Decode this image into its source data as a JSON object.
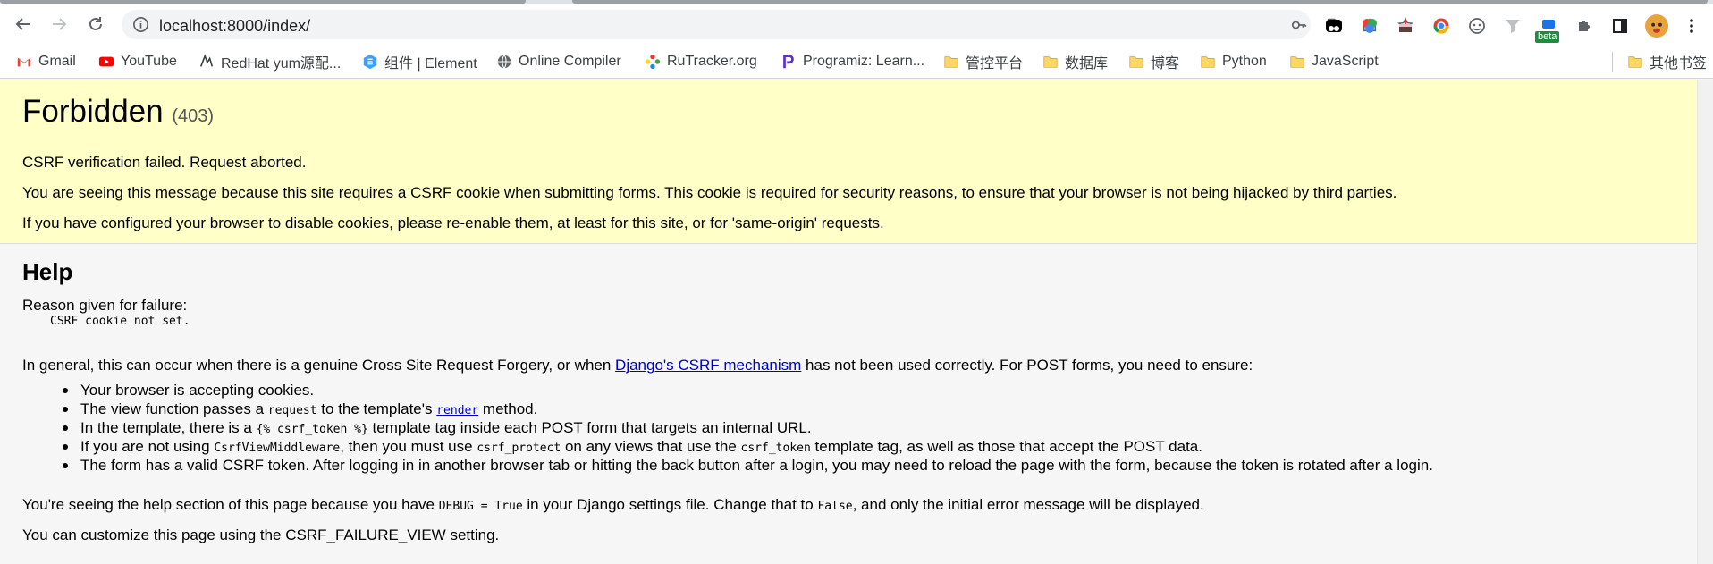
{
  "browser": {
    "url": "localhost:8000/index/",
    "extension_badge": "beta",
    "bookmarks": [
      {
        "label": "Gmail",
        "icon": "gmail-icon"
      },
      {
        "label": "YouTube",
        "icon": "youtube-icon"
      },
      {
        "label": "RedHat yum源配...",
        "icon": "redhat-icon"
      },
      {
        "label": "组件 | Element",
        "icon": "element-icon"
      },
      {
        "label": "Online Compiler",
        "icon": "globe-icon"
      },
      {
        "label": "RuTracker.org",
        "icon": "rutracker-icon"
      },
      {
        "label": "Programiz: Learn...",
        "icon": "programiz-icon"
      },
      {
        "label": "管控平台",
        "icon": "folder-icon"
      },
      {
        "label": "数据库",
        "icon": "folder-icon"
      },
      {
        "label": "博客",
        "icon": "folder-icon"
      },
      {
        "label": "Python",
        "icon": "folder-icon"
      },
      {
        "label": "JavaScript",
        "icon": "folder-icon"
      },
      {
        "label": "其他书签",
        "icon": "folder-icon"
      }
    ]
  },
  "error": {
    "title": "Forbidden",
    "code": "(403)",
    "message": "CSRF verification failed. Request aborted.",
    "explanation": "You are seeing this message because this site requires a CSRF cookie when submitting forms. This cookie is required for security reasons, to ensure that your browser is not being hijacked by third parties.",
    "cookies_hint": "If you have configured your browser to disable cookies, please re-enable them, at least for this site, or for 'same-origin' requests."
  },
  "help": {
    "heading": "Help",
    "reason_label": "Reason given for failure:",
    "reason": "CSRF cookie not set.",
    "general_before": "In general, this can occur when there is a genuine Cross Site Request Forgery, or when ",
    "general_link": "Django's CSRF mechanism",
    "general_after": " has not been used correctly. For POST forms, you need to ensure:",
    "tips": {
      "t1": "Your browser is accepting cookies.",
      "t2_a": "The view function passes a ",
      "t2_code": "request",
      "t2_b": " to the template's ",
      "t2_link": "render",
      "t2_c": " method.",
      "t3_a": "In the template, there is a ",
      "t3_code": "{% csrf_token %}",
      "t3_b": " template tag inside each POST form that targets an internal URL.",
      "t4_a": "If you are not using ",
      "t4_code1": "CsrfViewMiddleware",
      "t4_b": ", then you must use ",
      "t4_code2": "csrf_protect",
      "t4_c": " on any views that use the ",
      "t4_code3": "csrf_token",
      "t4_d": " template tag, as well as those that accept the POST data.",
      "t5": "The form has a valid CSRF token. After logging in in another browser tab or hitting the back button after a login, you may need to reload the page with the form, because the token is rotated after a login."
    },
    "debug_a": "You're seeing the help section of this page because you have ",
    "debug_code1": "DEBUG = True",
    "debug_b": " in your Django settings file. Change that to ",
    "debug_code2": "False",
    "debug_c": ", and only the initial error message will be displayed.",
    "customize": "You can customize this page using the CSRF_FAILURE_VIEW setting."
  },
  "colors": {
    "summary_bg": "#ffffc8",
    "page_bg": "#f6f6f6",
    "link": "#0000cc"
  }
}
